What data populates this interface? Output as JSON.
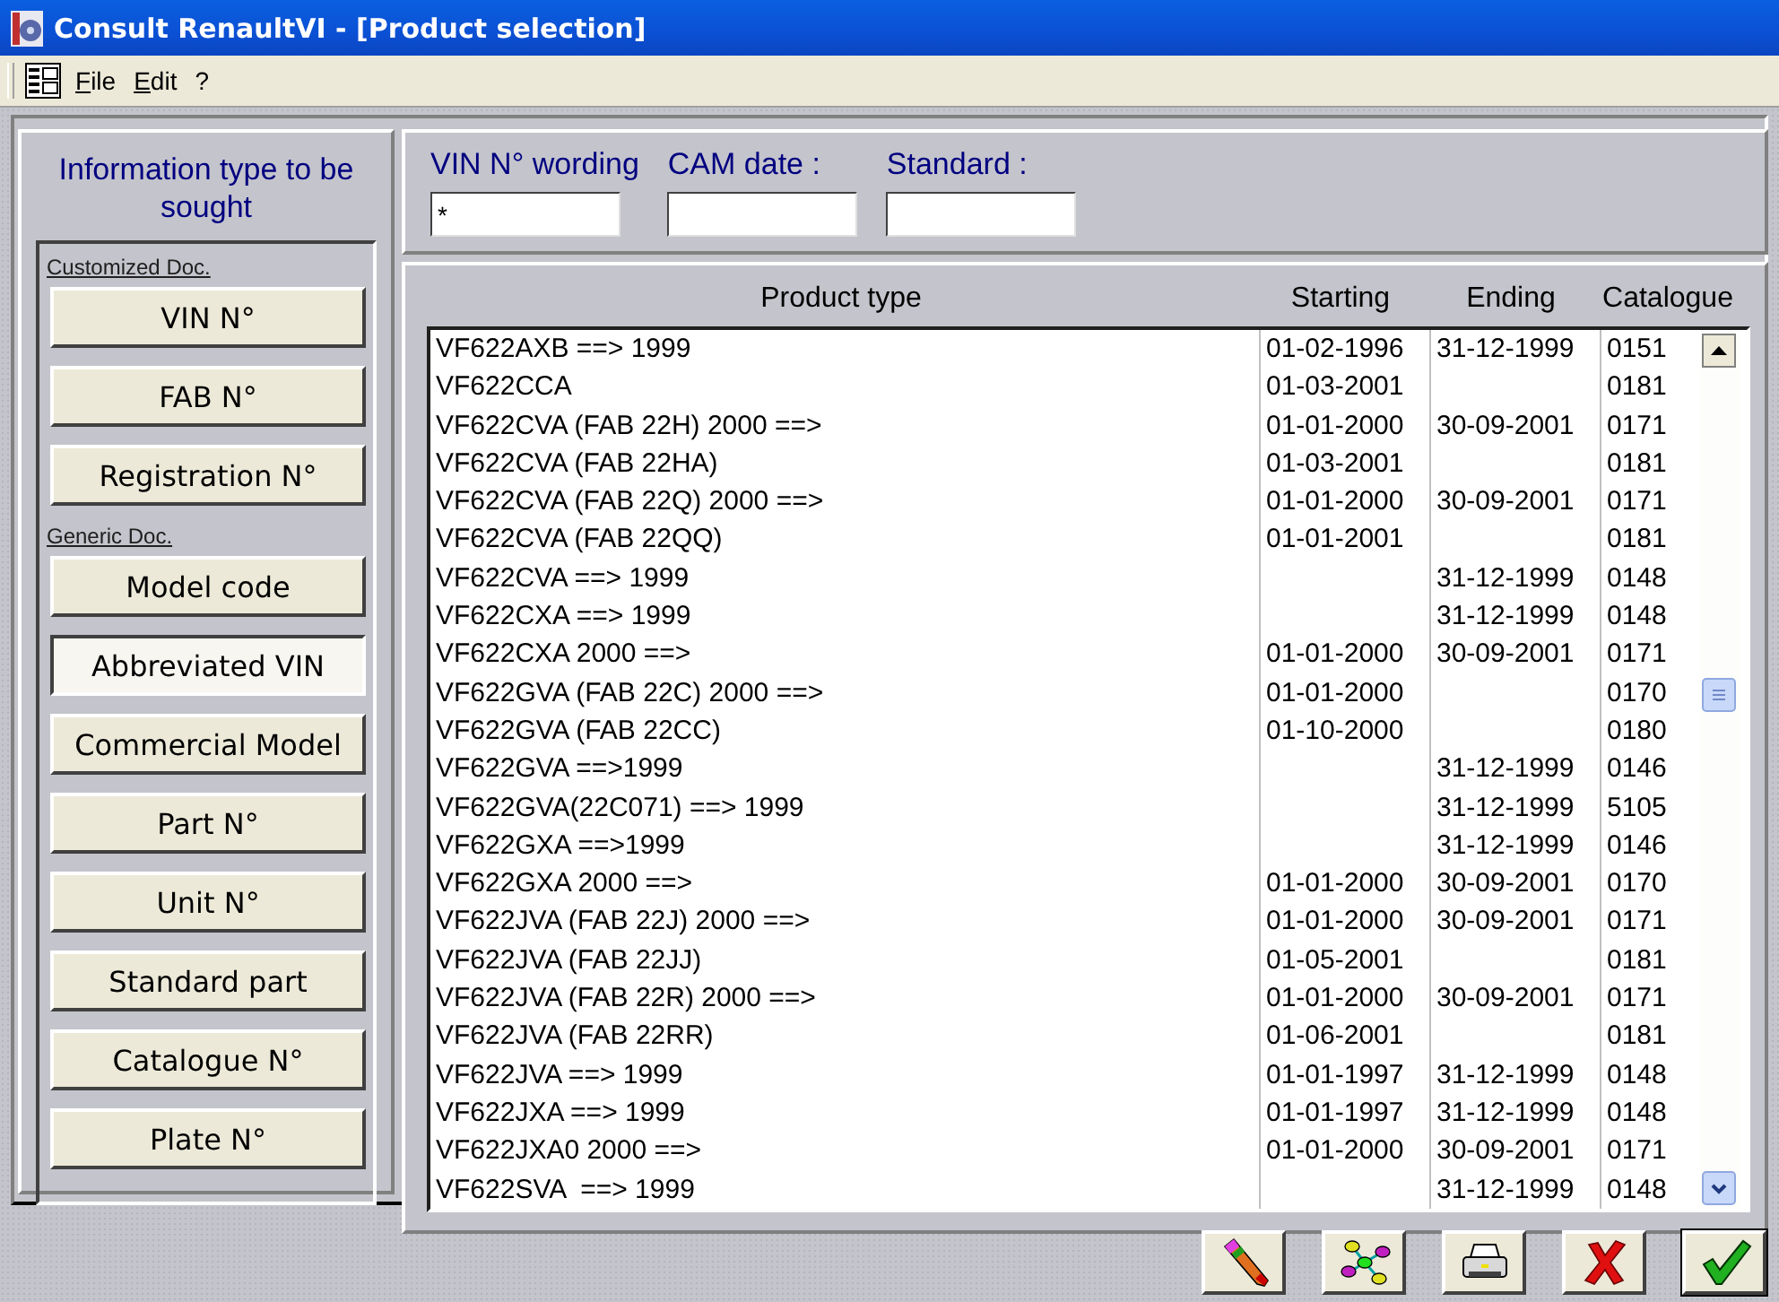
{
  "window": {
    "title": "Consult RenaultVI - [Product selection]"
  },
  "menu": [
    "File",
    "Edit",
    "?"
  ],
  "sidebar": {
    "heading": "Information type to be sought",
    "groups": [
      {
        "label": "Customized Doc.",
        "buttons": [
          {
            "label": "VIN N°",
            "selected": false
          },
          {
            "label": "FAB N°",
            "selected": false
          },
          {
            "label": "Registration N°",
            "selected": false
          }
        ]
      },
      {
        "label": "Generic Doc.",
        "buttons": [
          {
            "label": "Model code",
            "selected": false
          },
          {
            "label": "Abbreviated VIN",
            "selected": true
          },
          {
            "label": "Commercial Model",
            "selected": false
          },
          {
            "label": "Part N°",
            "selected": false
          },
          {
            "label": "Unit N°",
            "selected": false
          },
          {
            "label": "Standard part",
            "selected": false
          },
          {
            "label": "Catalogue N°",
            "selected": false
          },
          {
            "label": "Plate N°",
            "selected": false
          }
        ]
      }
    ]
  },
  "fields": [
    {
      "label": "VIN N° wording",
      "value": "*"
    },
    {
      "label": "CAM date :"
    },
    {
      "label": "Standard :"
    }
  ],
  "table": {
    "columns": [
      "Product type",
      "Starting",
      "Ending",
      "Catalogue"
    ],
    "rows": [
      [
        "VF622AXB ==> 1999",
        "01-02-1996",
        "31-12-1999",
        "0151"
      ],
      [
        "VF622CCA",
        "01-03-2001",
        "",
        "0181"
      ],
      [
        "VF622CVA (FAB 22H) 2000 ==>",
        "01-01-2000",
        "30-09-2001",
        "0171"
      ],
      [
        "VF622CVA (FAB 22HA)",
        "01-03-2001",
        "",
        "0181"
      ],
      [
        "VF622CVA (FAB 22Q) 2000 ==>",
        "01-01-2000",
        "30-09-2001",
        "0171"
      ],
      [
        "VF622CVA (FAB 22QQ)",
        "01-01-2001",
        "",
        "0181"
      ],
      [
        "VF622CVA ==> 1999",
        "",
        "31-12-1999",
        "0148"
      ],
      [
        "VF622CXA ==> 1999",
        "",
        "31-12-1999",
        "0148"
      ],
      [
        "VF622CXA 2000 ==>",
        "01-01-2000",
        "30-09-2001",
        "0171"
      ],
      [
        "VF622GVA (FAB 22C) 2000 ==>",
        "01-01-2000",
        "",
        "0170"
      ],
      [
        "VF622GVA (FAB 22CC)",
        "01-10-2000",
        "",
        "0180"
      ],
      [
        "VF622GVA ==>1999",
        "",
        "31-12-1999",
        "0146"
      ],
      [
        "VF622GVA(22C071) ==> 1999",
        "",
        "31-12-1999",
        "5105"
      ],
      [
        "VF622GXA ==>1999",
        "",
        "31-12-1999",
        "0146"
      ],
      [
        "VF622GXA 2000 ==>",
        "01-01-2000",
        "30-09-2001",
        "0170"
      ],
      [
        "VF622JVA (FAB 22J) 2000 ==>",
        "01-01-2000",
        "30-09-2001",
        "0171"
      ],
      [
        "VF622JVA (FAB 22JJ)",
        "01-05-2001",
        "",
        "0181"
      ],
      [
        "VF622JVA (FAB 22R) 2000 ==>",
        "01-01-2000",
        "30-09-2001",
        "0171"
      ],
      [
        "VF622JVA (FAB 22RR)",
        "01-06-2001",
        "",
        "0181"
      ],
      [
        "VF622JVA ==> 1999",
        "01-01-1997",
        "31-12-1999",
        "0148"
      ],
      [
        "VF622JXA ==> 1999",
        "01-01-1997",
        "31-12-1999",
        "0148"
      ],
      [
        "VF622JXA0 2000 ==>",
        "01-01-2000",
        "30-09-2001",
        "0171"
      ],
      [
        "VF622SVA  ==> 1999",
        "",
        "31-12-1999",
        "0148"
      ]
    ]
  }
}
